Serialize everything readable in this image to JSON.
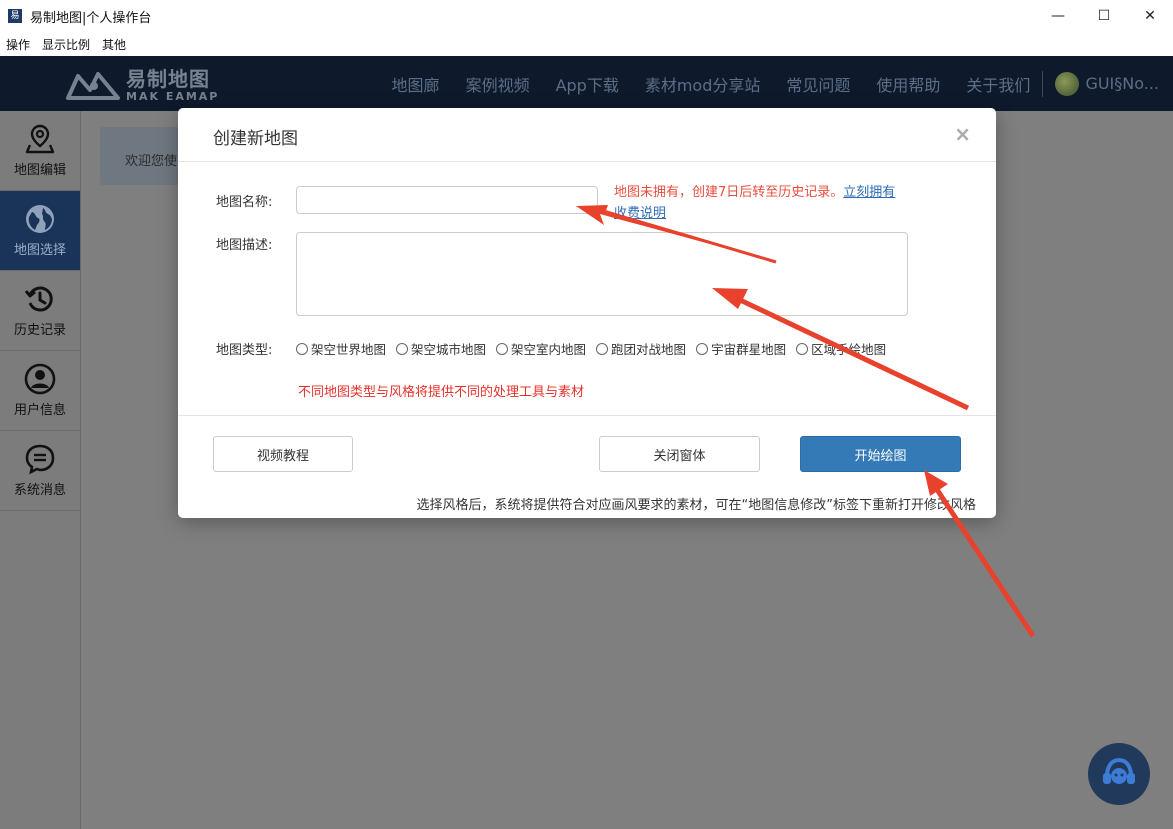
{
  "window": {
    "icon_text": "易",
    "title": "易制地图|个人操作台",
    "controls": [
      "—",
      "☐",
      "✕"
    ]
  },
  "menu": [
    "操作",
    "显示比例",
    "其他"
  ],
  "header": {
    "logo_cn": "易制地图",
    "logo_en": "MAK EAMAP",
    "nav": [
      "地图廊",
      "案例视频",
      "App下载",
      "素材mod分享站",
      "常见问题",
      "使用帮助",
      "关于我们"
    ],
    "user": "GUI§No..."
  },
  "sidebar": {
    "items": [
      {
        "label": "地图编辑",
        "icon": "map-pin-icon",
        "active": false
      },
      {
        "label": "地图选择",
        "icon": "globe-icon",
        "active": true
      },
      {
        "label": "历史记录",
        "icon": "history-icon",
        "active": false
      },
      {
        "label": "用户信息",
        "icon": "user-icon",
        "active": false
      },
      {
        "label": "系统消息",
        "icon": "message-icon",
        "active": false
      }
    ]
  },
  "content": {
    "welcome": "欢迎您使"
  },
  "modal": {
    "title": "创建新地图",
    "close": "×",
    "name_label": "地图名称:",
    "name_value": "",
    "hint_text": "地图未拥有，创建7日后转至历史记录。",
    "hint_link1": "立刻拥有",
    "hint_link2": "收费说明",
    "desc_label": "地图描述:",
    "type_label": "地图类型:",
    "types": [
      "架空世界地图",
      "架空城市地图",
      "架空室内地图",
      "跑团对战地图",
      "宇宙群星地图",
      "区域手绘地图"
    ],
    "type_note": "不同地图类型与风格将提供不同的处理工具与素材",
    "btn_tutorial": "视频教程",
    "btn_close": "关闭窗体",
    "btn_start": "开始绘图",
    "footer_note": "选择风格后，系统将提供符合对应画风要求的素材，可在“地图信息修改”标签下重新打开修改风格"
  },
  "colors": {
    "header_bg": "#0e1a2c",
    "sidebar_active": "#1a3358",
    "primary": "#337ab7",
    "warning_text": "#e84c3d",
    "arrow": "#e8412c"
  }
}
